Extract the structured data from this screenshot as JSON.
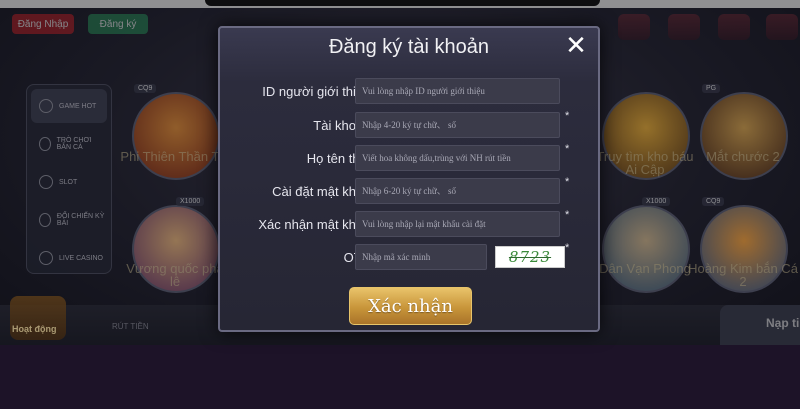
{
  "header": {
    "login_label": "Đăng Nhập",
    "register_label": "Đăng ký"
  },
  "top_menu": [
    "",
    "",
    "",
    ""
  ],
  "side_menu": [
    {
      "label": "GAME HOT",
      "active": true
    },
    {
      "label": "TRÒ CHƠI BẮN CÁ",
      "active": false
    },
    {
      "label": "SLOT",
      "active": false
    },
    {
      "label": "ĐỔI CHIẾN KỲ BÀI",
      "active": false
    },
    {
      "label": "LIVE CASINO",
      "active": false
    }
  ],
  "games": [
    {
      "name": "Phi Thiên Thần Tài",
      "badge": "CQ9"
    },
    {
      "name": "Vương quốc pha lê",
      "badge": "X1000"
    },
    {
      "name": "Truy tìm kho báu Ai Cập",
      "badge": ""
    },
    {
      "name": "Dân Vạn Phong",
      "badge": "X1000"
    },
    {
      "name": "Mắt chước 2",
      "badge": "PG"
    },
    {
      "name": "Hoàng Kim bắn Cá 2",
      "badge": "CQ9"
    }
  ],
  "bottom": {
    "activity_label": "Hoạt động",
    "withdraw_label": "RÚT TIỀN",
    "deposit_label": "Nạp ti"
  },
  "modal": {
    "title": "Đăng ký tài khoản",
    "fields": [
      {
        "label": "ID người giới thiệu:",
        "placeholder": "Vui lòng nhập ID người giới thiệu",
        "required": false
      },
      {
        "label": "Tài khoản:",
        "placeholder": "Nhập 4-20 ký tự chữ、 số",
        "required": true
      },
      {
        "label": "Họ tên thật:",
        "placeholder": "Viết hoa không dấu,trùng với NH rút tiền",
        "required": true
      },
      {
        "label": "Cài đặt mật khẩu:",
        "placeholder": "Nhập 6-20 ký tự chữ、 số",
        "required": true
      },
      {
        "label": "Xác nhận mật khẩu:",
        "placeholder": "Vui lòng nhập lại mật khẩu cài đặt",
        "required": true
      },
      {
        "label": "OTP:",
        "placeholder": "Nhập mã xác minh",
        "required": true
      }
    ],
    "required_mark": "*",
    "captcha_text": "8723",
    "submit_label": "Xác nhận",
    "close_symbol": "✕"
  }
}
